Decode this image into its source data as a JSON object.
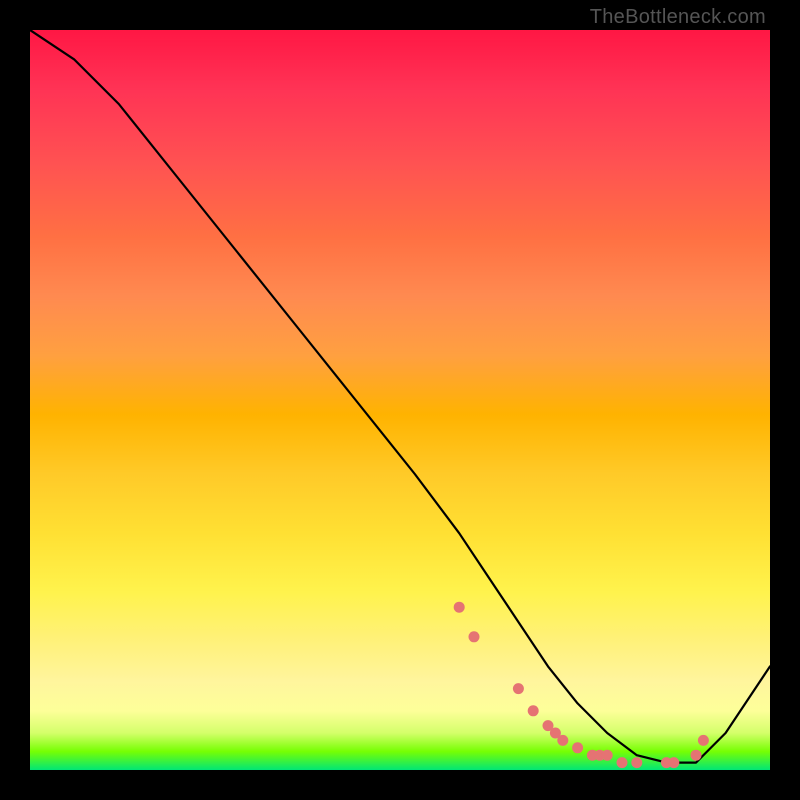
{
  "watermark": "TheBottleneck.com",
  "chart_data": {
    "type": "line",
    "title": "",
    "xlabel": "",
    "ylabel": "",
    "xlim": [
      0,
      100
    ],
    "ylim": [
      0,
      100
    ],
    "line": {
      "x": [
        0,
        6,
        12,
        20,
        28,
        36,
        44,
        52,
        58,
        62,
        66,
        70,
        74,
        78,
        82,
        86,
        90,
        94,
        100
      ],
      "y": [
        100,
        96,
        90,
        80,
        70,
        60,
        50,
        40,
        32,
        26,
        20,
        14,
        9,
        5,
        2,
        1,
        1,
        5,
        14
      ]
    },
    "points": {
      "color": "#e57373",
      "x": [
        58,
        60,
        66,
        68,
        70,
        71,
        72,
        74,
        76,
        77,
        78,
        80,
        82,
        86,
        87,
        90,
        91
      ],
      "y": [
        22,
        18,
        11,
        8,
        6,
        5,
        4,
        3,
        2,
        2,
        2,
        1,
        1,
        1,
        1,
        2,
        4
      ]
    }
  }
}
